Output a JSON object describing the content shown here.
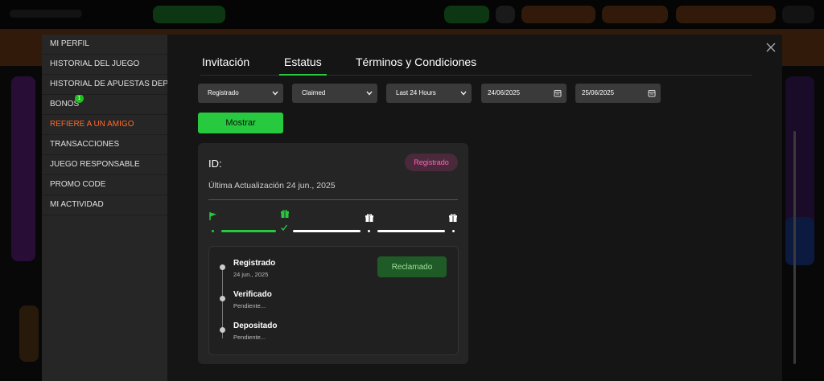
{
  "sidebar": {
    "items": [
      {
        "label": "MI PERFIL"
      },
      {
        "label": "HISTORIAL DEL JUEGO"
      },
      {
        "label": "HISTORIAL DE APUESTAS DEP..."
      },
      {
        "label": "BONOS",
        "badge": "1"
      },
      {
        "label": "REFIERE A UN AMIGO",
        "active": true
      },
      {
        "label": "TRANSACCIONES"
      },
      {
        "label": "JUEGO RESPONSABLE"
      },
      {
        "label": "PROMO CODE"
      },
      {
        "label": "MI ACTIVIDAD"
      }
    ]
  },
  "tabs": [
    {
      "label": "Invitación"
    },
    {
      "label": "Estatus",
      "active": true
    },
    {
      "label": "Términos y Condiciones"
    }
  ],
  "filters": {
    "status": "Registrado",
    "claim": "Claimed",
    "period": "Last 24 Hours",
    "date_from": "24/06/2025",
    "date_to": "25/06/2025",
    "show_label": "Mostrar"
  },
  "card": {
    "id_label": "ID:",
    "status_pill": "Registrado",
    "updated": "Última Actualización 24 jun., 2025",
    "claimed_label": "Reclamado",
    "steps": [
      {
        "title": "Registrado",
        "sub": "24 jun., 2025"
      },
      {
        "title": "Verificado",
        "sub": "Pendiente..."
      },
      {
        "title": "Depositado",
        "sub": "Pendiente..."
      }
    ]
  },
  "colors": {
    "accent": "#27c93f",
    "active_link": "#ff6a2a",
    "pill_text": "#ff64c0"
  },
  "icons": [
    "close-icon",
    "chevron-down-icon",
    "calendar-icon",
    "flag-icon",
    "gift-icon",
    "checkmark-icon"
  ]
}
